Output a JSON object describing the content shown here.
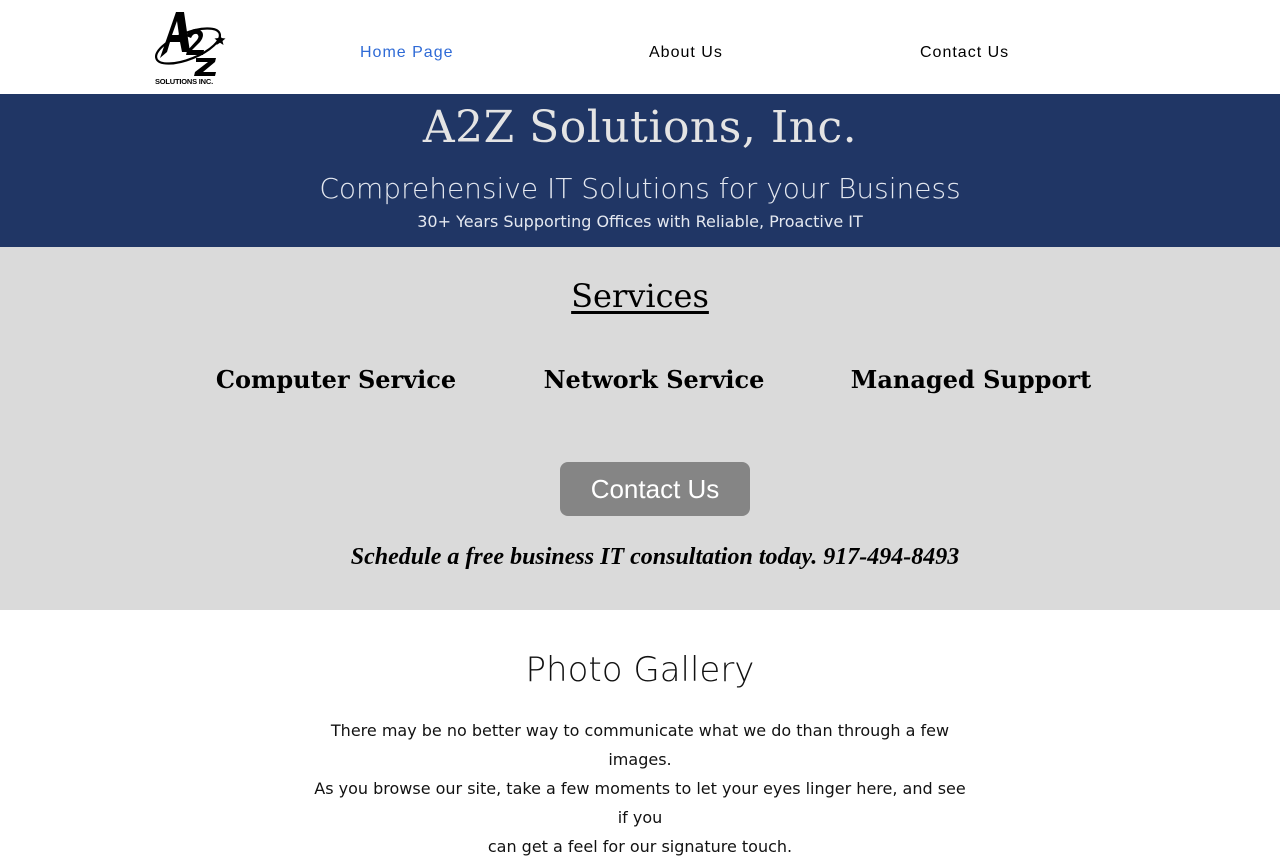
{
  "header": {
    "logo_caption": "SOLUTIONS INC.",
    "nav": [
      {
        "label": "Home Page",
        "active": true
      },
      {
        "label": "About Us",
        "active": false
      },
      {
        "label": "Contact Us",
        "active": false
      }
    ]
  },
  "hero": {
    "title": "A2Z Solutions, Inc.",
    "subtitle": "Comprehensive IT Solutions for your Business",
    "tagline": "30+ Years Supporting Offices with Reliable, Proactive IT"
  },
  "services": {
    "title": "Services",
    "items": [
      "Computer Service",
      "Network Service",
      "Managed Support"
    ],
    "button_label": "Contact Us",
    "consult_text": "Schedule a free business IT consultation today. 917-494-8493"
  },
  "gallery": {
    "title": "Photo Gallery",
    "lines": [
      "There may be no better way to communicate what we do than through a few images.",
      "As you browse our site, take a few moments to let your eyes linger here, and see if you",
      "can get a feel for our signature touch."
    ]
  },
  "colors": {
    "nav_active": "#2e6ad6",
    "hero_bg": "#203665",
    "services_bg": "#dadada",
    "button_bg": "#858585"
  }
}
